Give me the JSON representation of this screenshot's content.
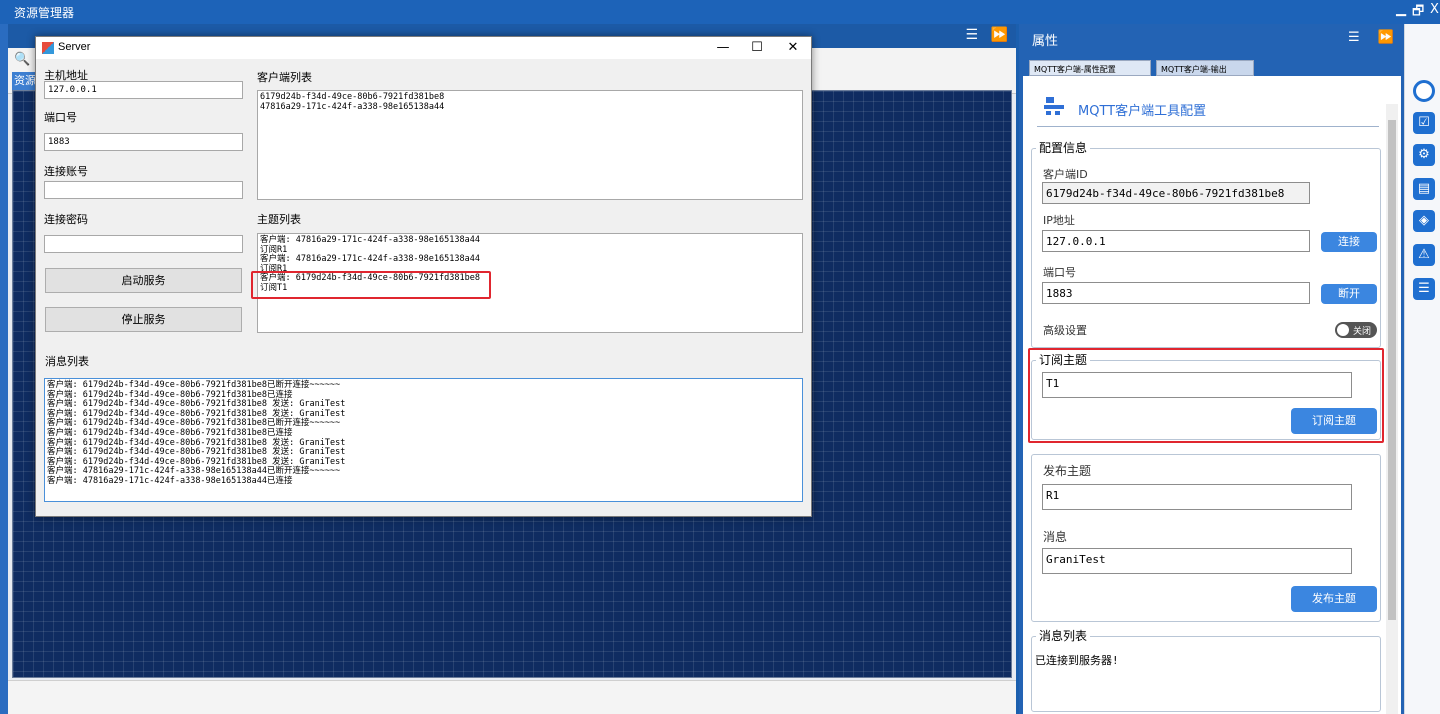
{
  "topbar": {
    "title": "资源管理器",
    "min": "▁",
    "restore": "🗗",
    "close": "X"
  },
  "explorer": {
    "menu_icon": "☰",
    "pin_icon": "⏩",
    "search_icon": "🔍",
    "tab_stub": "资源"
  },
  "server": {
    "title": "Server",
    "min": "—",
    "max": "☐",
    "close": "✕",
    "host_label": "主机地址",
    "host_value": "127.0.0.1",
    "port_label": "端口号",
    "port_value": "1883",
    "account_label": "连接账号",
    "account_value": "",
    "password_label": "连接密码",
    "password_value": "",
    "start_btn": "启动服务",
    "stop_btn": "停止服务",
    "clients_label": "客户端列表",
    "clients": [
      "6179d24b-f34d-49ce-80b6-7921fd381be8",
      "47816a29-171c-424f-a338-98e165138a44"
    ],
    "topics_label": "主题列表",
    "topics": [
      "客户端: 47816a29-171c-424f-a338-98e165138a44",
      "订阅R1",
      "客户端: 47816a29-171c-424f-a338-98e165138a44",
      "订阅R1",
      "客户端: 6179d24b-f34d-49ce-80b6-7921fd381be8",
      "订阅T1"
    ],
    "messages_label": "消息列表",
    "messages": [
      "客户端: 6179d24b-f34d-49ce-80b6-7921fd381be8已断开连接~~~~~~",
      "客户端: 6179d24b-f34d-49ce-80b6-7921fd381be8已连接",
      "客户端: 6179d24b-f34d-49ce-80b6-7921fd381be8    发送: GraniTest",
      "客户端: 6179d24b-f34d-49ce-80b6-7921fd381be8    发送: GraniTest",
      "客户端: 6179d24b-f34d-49ce-80b6-7921fd381be8已断开连接~~~~~~",
      "客户端: 6179d24b-f34d-49ce-80b6-7921fd381be8已连接",
      "客户端: 6179d24b-f34d-49ce-80b6-7921fd381be8    发送: GraniTest",
      "客户端: 6179d24b-f34d-49ce-80b6-7921fd381be8    发送: GraniTest",
      "客户端: 6179d24b-f34d-49ce-80b6-7921fd381be8    发送: GraniTest",
      "客户端: 47816a29-171c-424f-a338-98e165138a44已断开连接~~~~~~",
      "客户端: 47816a29-171c-424f-a338-98e165138a44已连接"
    ]
  },
  "props": {
    "title": "属性",
    "tab1": "MQTT客户端-属性配置",
    "tab2": "MQTT客户端-输出",
    "tool_title": "MQTT客户端工具配置",
    "config_section": "配置信息",
    "client_id_label": "客户端ID",
    "client_id_value": "6179d24b-f34d-49ce-80b6-7921fd381be8",
    "ip_label": "IP地址",
    "ip_value": "127.0.0.1",
    "connect_btn": "连接",
    "port_label": "端口号",
    "port_value": "1883",
    "disconnect_btn": "断开",
    "advanced_label": "高级设置",
    "advanced_toggle": "关闭",
    "subscribe_section": "订阅主题",
    "subscribe_value": "T1",
    "subscribe_btn": "订阅主题",
    "publish_section": "发布主题",
    "publish_topic_value": "R1",
    "message_label": "消息",
    "message_value": "GraniTest",
    "publish_btn": "发布主题",
    "msglist_section": "消息列表",
    "msglist_value": "已连接到服务器!"
  },
  "accent_color": "#1d63b8",
  "highlight_color": "#e0262f"
}
